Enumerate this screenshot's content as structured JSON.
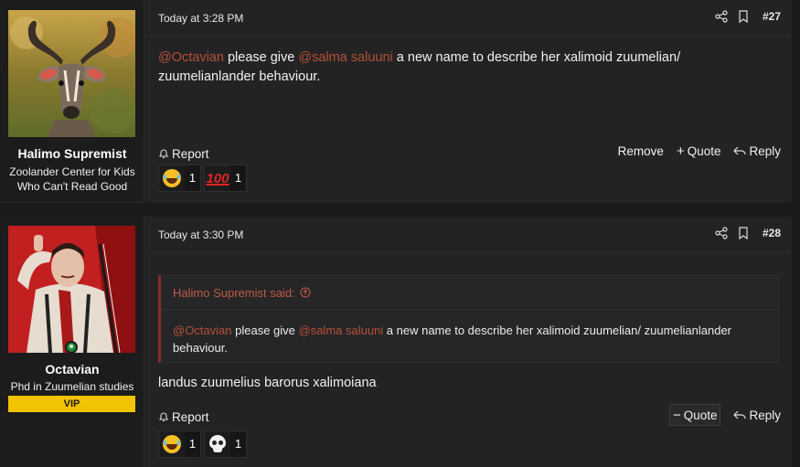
{
  "posts": [
    {
      "user": {
        "name": "Halimo Supremist",
        "title": "Zoolander Center for Kids Who Can't Read Good"
      },
      "timestamp": "Today at 3:28 PM",
      "number": "#27",
      "body": {
        "mention1": "@Octavian",
        "text1": " please give ",
        "mention2": "@salma saluuni",
        "text2": " a new name to describe her xalimoid zuumelian/ zuumelianlander behaviour."
      },
      "actions": {
        "report": "Report",
        "remove": "Remove",
        "quote": "Quote",
        "reply": "Reply"
      },
      "reactions": [
        {
          "icon": "laughing-tears-icon",
          "count": "1"
        },
        {
          "icon": "hundred-points-icon",
          "label": "100",
          "count": "1"
        }
      ]
    },
    {
      "user": {
        "name": "Octavian",
        "title": "Phd in Zuumelian studies",
        "badge": "VIP"
      },
      "timestamp": "Today at 3:30 PM",
      "number": "#28",
      "quote": {
        "author_line": "Halimo Supremist said:",
        "mention1": "@Octavian",
        "text1": " please give ",
        "mention2": "@salma saluuni",
        "text2": " a new name to describe her xalimoid zuumelian/ zuumelianlander behaviour."
      },
      "body": {
        "text": "landus zuumelius barorus xalimoiana"
      },
      "actions": {
        "report": "Report",
        "quote": "Quote",
        "reply": "Reply"
      },
      "reactions": [
        {
          "icon": "laughing-tears-icon",
          "count": "1"
        },
        {
          "icon": "skull-icon",
          "count": "1"
        }
      ]
    }
  ],
  "colors": {
    "background": "#1a1a1a",
    "post_background": "#232323",
    "mention": "#b5503a",
    "quote_accent": "#8a2b2b",
    "vip_badge": "#f2c300",
    "online": "#1f8b3a"
  }
}
